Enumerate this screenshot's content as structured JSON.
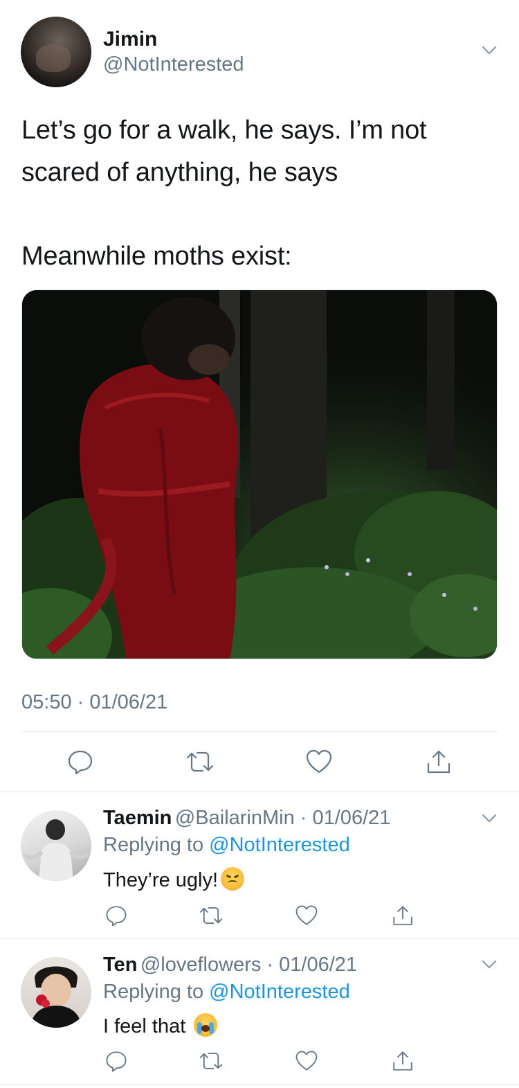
{
  "tweet": {
    "author_name": "Jimin",
    "author_handle": "@NotInterested",
    "text_line1": "Let’s go for a walk, he says. I’m not",
    "text_line2": "scared of anything, he says",
    "text_line3": "Meanwhile moths exist:",
    "timestamp": "05:50 · 01/06/21",
    "avatar_icon": "user-avatar",
    "menu_icon": "chevron-down-icon"
  },
  "actions": {
    "reply_icon": "reply-icon",
    "retweet_icon": "retweet-icon",
    "like_icon": "heart-icon",
    "share_icon": "share-icon"
  },
  "replies": [
    {
      "name": "Taemin",
      "meta": "@BailarinMin · 01/06/21",
      "replying_prefix": "Replying to",
      "replying_to": "@NotInterested",
      "text": "They’re ugly!",
      "emoji": "confounded-face"
    },
    {
      "name": "Ten",
      "meta": "@loveflowers · 01/06/21",
      "replying_prefix": "Replying to",
      "replying_to": "@NotInterested",
      "text": "I feel that",
      "emoji": "loudly-crying-face"
    }
  ],
  "colors": {
    "text": "#14171a",
    "secondary": "#657786",
    "link": "#1b95e0",
    "divider": "#e1e8ed"
  }
}
